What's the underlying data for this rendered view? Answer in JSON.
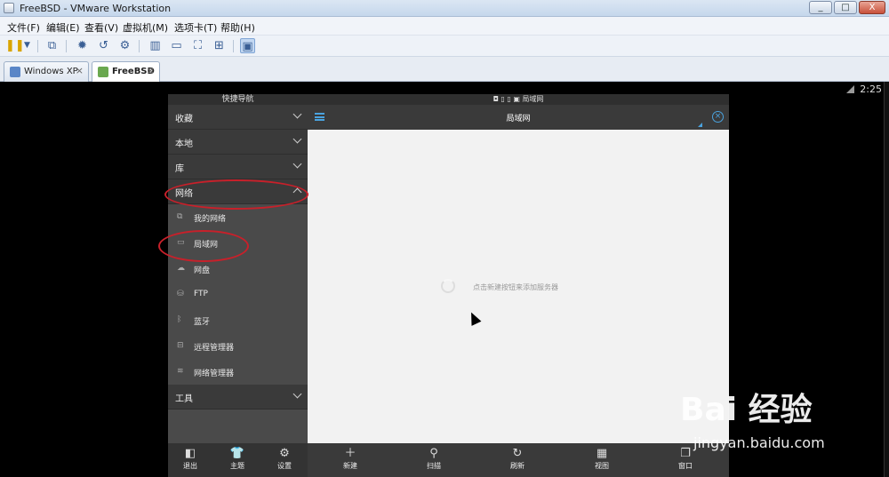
{
  "window": {
    "title": "FreeBSD - VMware Workstation",
    "buttons": [
      "_",
      "□",
      "X"
    ]
  },
  "menubar": [
    "文件(F)",
    "编辑(E)",
    "查看(V)",
    "虚拟机(M)",
    "选项卡(T)",
    "帮助(H)"
  ],
  "toolbar_icons": [
    "pause-icon",
    "dropdown-icon",
    "network-icon",
    "snapshot-icon",
    "revert-icon",
    "manage-icon",
    "sidebar-icon",
    "console-icon",
    "fullscreen-icon",
    "unity-icon",
    "view-icon"
  ],
  "tabs": [
    {
      "label": "Windows XP",
      "close": "×"
    },
    {
      "label": "FreeBSD",
      "close": "×"
    }
  ],
  "guest": {
    "clock": "2:25",
    "sidebar": {
      "title": "快捷导航",
      "sections": {
        "favorites": "收藏",
        "local": "本地",
        "library": "库",
        "network": "网络",
        "tools": "工具"
      },
      "network_items": {
        "my_network": "我的网络",
        "lan": "局域网",
        "netdisk": "网盘",
        "ftp": "FTP",
        "bluetooth": "蓝牙",
        "remote_manager": "远程管理器",
        "network_manager": "网络管理器"
      },
      "bottom": {
        "exit": "退出",
        "theme": "主题",
        "settings": "设置"
      }
    },
    "status_label": "局域网",
    "appbar_title": "局域网",
    "empty_hint": "点击新建按钮来添加服务器",
    "bottom_actions": {
      "new": "新建",
      "scan": "扫描",
      "refresh": "刷新",
      "view": "视图",
      "window": "窗口"
    }
  },
  "watermark": {
    "brand": "Bai 经验",
    "url": "jingyan.baidu.com"
  },
  "colors": {
    "accent": "#4aa3df",
    "annotation": "#c8202a"
  }
}
